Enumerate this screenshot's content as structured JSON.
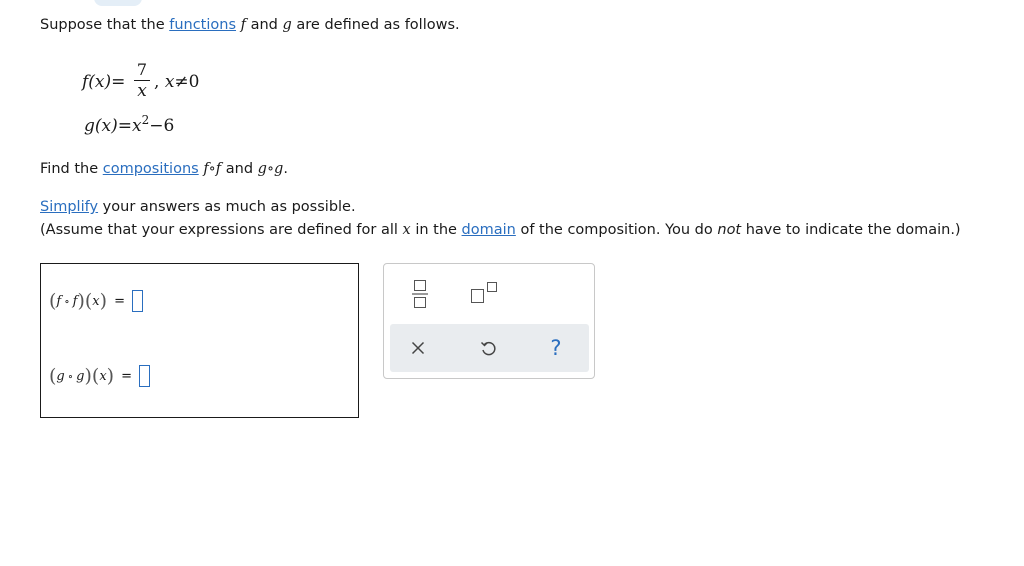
{
  "intro": {
    "prefix": "Suppose that the",
    "link_functions": "functions",
    "f": "f",
    "and": "and",
    "g": "g",
    "suffix": "are defined as follows."
  },
  "definitions": {
    "f_lhs": "f(x)=",
    "f_num": "7",
    "f_den": "x",
    "f_comma": ",",
    "f_cond_var": "x",
    "f_cond_rest": "≠0",
    "g_lhs": "g(x)=",
    "g_base": "x",
    "g_exp": "2",
    "g_tail": "−6"
  },
  "find": {
    "prefix": "Find the",
    "link_compositions": "compositions",
    "comp1": "f∘f",
    "and": "and",
    "comp2": "g∘g",
    "period": "."
  },
  "simplify": {
    "link": "Simplify",
    "rest": "your answers as much as possible."
  },
  "assume": {
    "part1": "(Assume that your expressions are defined for all",
    "var": "x",
    "part2": "in the",
    "link_domain": "domain",
    "part3": "of the composition. You do",
    "emph": "not",
    "part4": "have to indicate the domain.)"
  },
  "answers": {
    "ff": {
      "f1": "f",
      "op": "∘",
      "f2": "f",
      "x": "x",
      "eq": "="
    },
    "gg": {
      "g1": "g",
      "op": "∘",
      "g2": "g",
      "x": "x",
      "eq": "="
    }
  },
  "toolbar": {
    "icons": [
      "fraction-icon",
      "exponent-icon",
      "close-icon",
      "undo-icon",
      "help-icon"
    ],
    "help_label": "?"
  },
  "colors": {
    "link": "#2a6ebf",
    "toolbar_strip": "#e9ecef",
    "toolbar_border": "#c8c8c8"
  }
}
